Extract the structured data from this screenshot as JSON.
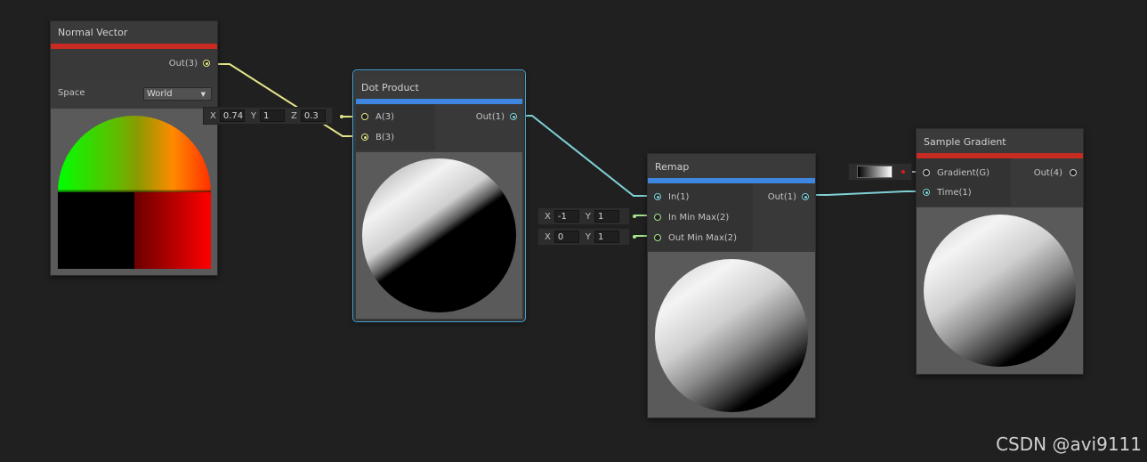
{
  "nodes": {
    "normal_vector": {
      "title": "Normal Vector",
      "out_label": "Out(3)",
      "space_label": "Space",
      "space_value": "World"
    },
    "dot_product": {
      "title": "Dot Product",
      "in_a_label": "A(3)",
      "in_b_label": "B(3)",
      "out_label": "Out(1)",
      "b_field": {
        "x_label": "X",
        "x": "0.74",
        "y_label": "Y",
        "y": "1",
        "z_label": "Z",
        "z": "0.3"
      }
    },
    "remap": {
      "title": "Remap",
      "in_label": "In(1)",
      "in_min_max_label": "In Min Max(2)",
      "out_min_max_label": "Out Min Max(2)",
      "out_label": "Out(1)",
      "in_min_max_field": {
        "x_label": "X",
        "x": "-1",
        "y_label": "Y",
        "y": "1"
      },
      "out_min_max_field": {
        "x_label": "X",
        "x": "0",
        "y_label": "Y",
        "y": "1"
      }
    },
    "sample_gradient": {
      "title": "Sample Gradient",
      "gradient_label": "Gradient(G)",
      "time_label": "Time(1)",
      "out_label": "Out(4)"
    }
  },
  "colors": {
    "background": "#202020",
    "node_body": "#393939",
    "red_bar": "#c72b22",
    "blue_bar": "#3f86e0",
    "wire_vector3": "#e5e58a",
    "wire_vector1": "#7fd1d6",
    "wire_vector2": "#a8e48f",
    "selection": "#49a6d8"
  },
  "watermark": "CSDN @avi9111"
}
